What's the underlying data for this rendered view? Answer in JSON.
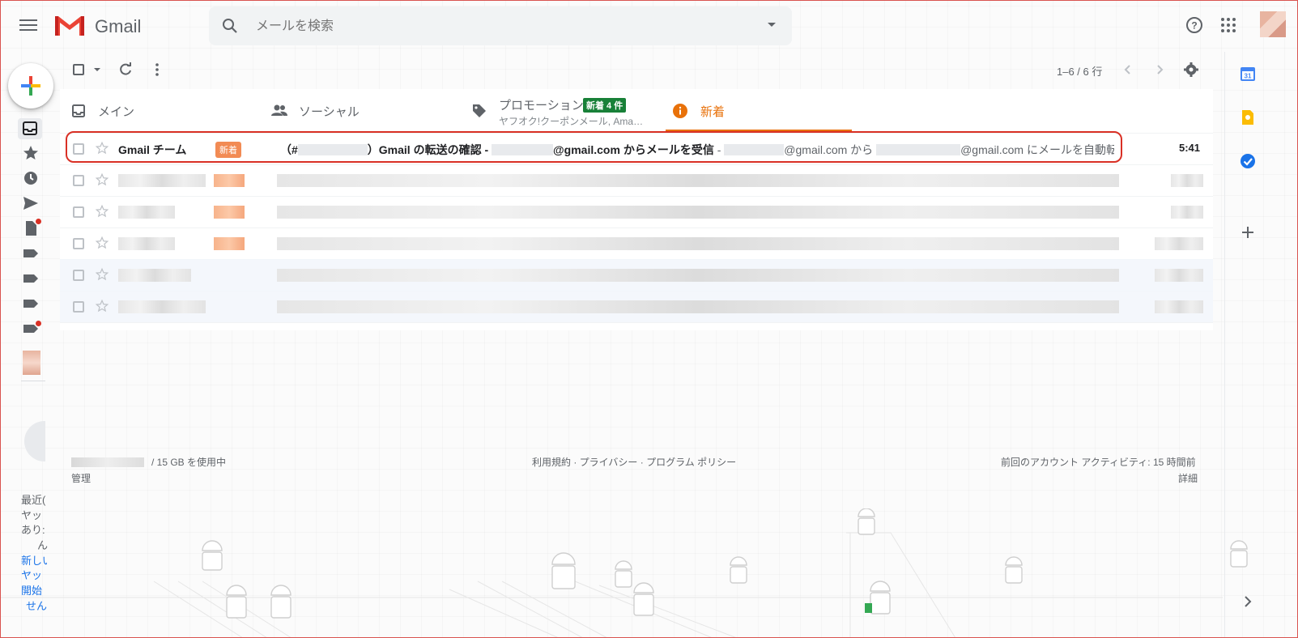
{
  "app": {
    "name": "Gmail"
  },
  "search": {
    "placeholder": "メールを検索"
  },
  "toolbar": {
    "pagination": "1–6 / 6 行"
  },
  "tabs": [
    {
      "label": "メイン"
    },
    {
      "label": "ソーシャル"
    },
    {
      "label": "プロモーション",
      "badge": "新着 4 件",
      "sub": "ヤフオク!クーポンメール, Ama…"
    },
    {
      "label": "新着"
    }
  ],
  "emails": [
    {
      "sender": "Gmail チーム",
      "label": "新着",
      "subject_prefix": "（#",
      "subject_mid": "）Gmail の転送の確認 - ",
      "subject_end": "@gmail.com からメールを受信",
      "snippet_sep": " - ",
      "snippet_a": "@gmail.com から ",
      "snippet_b": "@gmail.com にメールを自動転送する…",
      "time": "5:41"
    }
  ],
  "footer": {
    "storage": "/ 15 GB を使用中",
    "manage": "管理",
    "links": "利用規約 · プライバシー · プログラム ポリシー",
    "activity": "前回のアカウント アクティビティ: 15 時間前",
    "details": "詳細"
  },
  "sidebar_text": [
    "最近(",
    "ヤッ",
    "あり:",
    "ん",
    "新しい",
    "ヤッ",
    "開始",
    "せん"
  ],
  "colors": {
    "accent_red": "#d93025",
    "new_orange": "#e8710a",
    "promo_green": "#188038"
  }
}
